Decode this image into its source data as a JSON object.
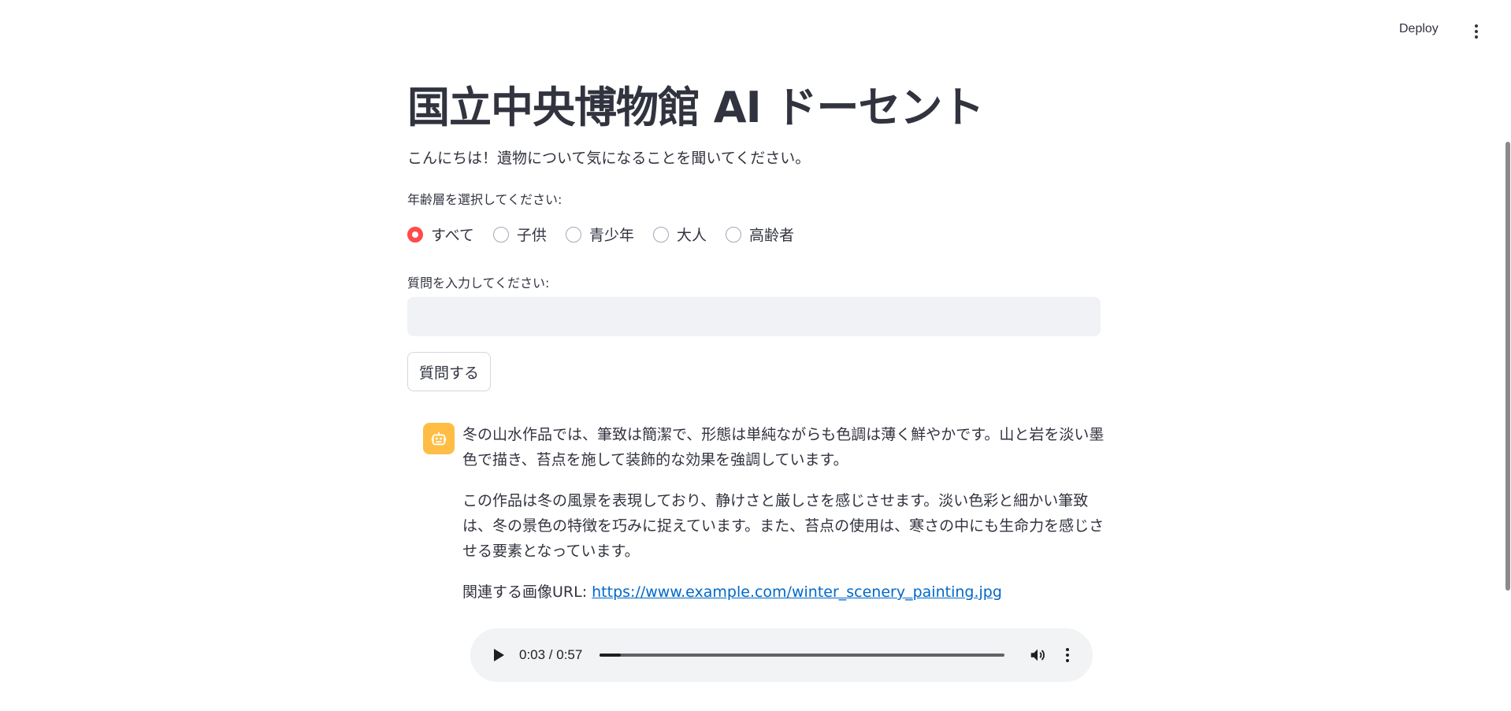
{
  "header": {
    "deploy_label": "Deploy",
    "menu_icon": "kebab-menu-icon"
  },
  "main": {
    "title": "国立中央博物館 AI ドーセント",
    "greeting": "こんにちは！遺物について気になることを聞いてください。",
    "age_label": "年齢層を選択してください:",
    "age_options": [
      {
        "label": "すべて",
        "selected": true
      },
      {
        "label": "子供",
        "selected": false
      },
      {
        "label": "青少年",
        "selected": false
      },
      {
        "label": "大人",
        "selected": false
      },
      {
        "label": "高齢者",
        "selected": false
      }
    ],
    "question_label": "質問を入力してください:",
    "question_value": "",
    "ask_button": "質問する"
  },
  "chat": {
    "avatar_icon": "robot-icon",
    "avatar_color": "#ffbd45",
    "paragraph1": "冬の山水作品では、筆致は簡潔で、形態は単純ながらも色調は薄く鮮やかです。山と岩を淡い墨色で描き、苔点を施して装飾的な効果を強調しています。",
    "paragraph2": "この作品は冬の風景を表現しており、静けさと厳しさを感じさせます。淡い色彩と細かい筆致は、冬の景色の特徴を巧みに捉えています。また、苔点の使用は、寒さの中にも生命力を感じさせる要素となっています。",
    "url_prefix": "関連する画像URL: ",
    "url": "https://www.example.com/winter_scenery_painting.jpg"
  },
  "audio": {
    "time": "0:03 / 0:57",
    "progress_fraction": 0.0526
  },
  "colors": {
    "accent": "#ff4b4b",
    "text": "#31333f",
    "link": "#0068c9",
    "input_bg": "#f0f2f6"
  }
}
